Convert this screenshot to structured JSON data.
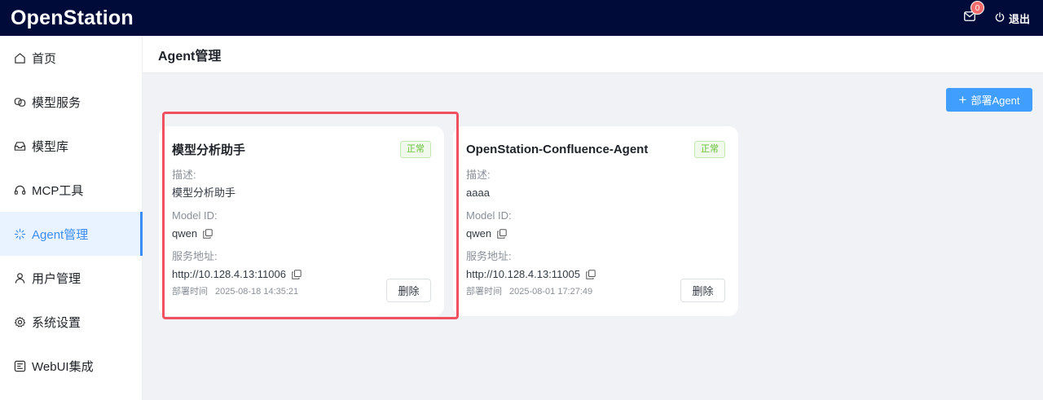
{
  "app": {
    "brand": "OpenStation"
  },
  "topbar": {
    "notification_count": "0",
    "logout_label": "退出"
  },
  "sidebar": {
    "items": [
      {
        "label": "首页",
        "icon": "home-icon"
      },
      {
        "label": "模型服务",
        "icon": "model-service-icon"
      },
      {
        "label": "模型库",
        "icon": "model-library-icon"
      },
      {
        "label": "MCP工具",
        "icon": "headset-icon"
      },
      {
        "label": "Agent管理",
        "icon": "sparkle-icon",
        "active": true
      },
      {
        "label": "用户管理",
        "icon": "user-icon"
      },
      {
        "label": "系统设置",
        "icon": "gear-icon"
      },
      {
        "label": "WebUI集成",
        "icon": "webui-icon"
      }
    ]
  },
  "page": {
    "title": "Agent管理",
    "deploy_button": "部署Agent"
  },
  "cards": [
    {
      "title": "模型分析助手",
      "status": "正常",
      "desc_label": "描述:",
      "desc": "模型分析助手",
      "model_label": "Model ID:",
      "model_id": "qwen",
      "addr_label": "服务地址:",
      "address": "http://10.128.4.13:11006",
      "time_label": "部署时间",
      "deploy_time": "2025-08-18 14:35:21",
      "delete_label": "删除"
    },
    {
      "title": "OpenStation-Confluence-Agent",
      "status": "正常",
      "desc_label": "描述:",
      "desc": "aaaa",
      "model_label": "Model ID:",
      "model_id": "qwen",
      "addr_label": "服务地址:",
      "address": "http://10.128.4.13:11005",
      "time_label": "部署时间",
      "deploy_time": "2025-08-01 17:27:49",
      "delete_label": "删除"
    }
  ],
  "colors": {
    "topbar": "#000b3a",
    "accent": "#409eff",
    "status_ok": "#67c23a",
    "highlight": "#f0505f"
  }
}
